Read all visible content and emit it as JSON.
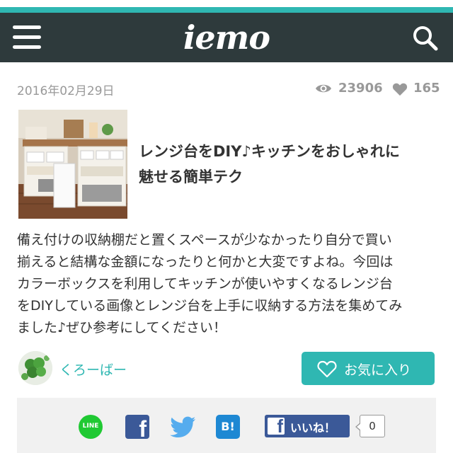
{
  "header": {
    "logo": "iemo",
    "menu_icon": "hamburger-menu-icon",
    "search_icon": "search-icon",
    "accent_color": "#2fb7b2",
    "bar_color": "#2e3a3c"
  },
  "article": {
    "date": "2016年02月29日",
    "views": "23906",
    "likes": "165",
    "title_line1": "レンジ台をDIY♪キッチンをおしゃれに",
    "title_line2": "魅せる簡単テク",
    "body_lines": [
      "備え付けの収納棚だと置くスペースが少なかったり自分で買い",
      "揃えると結構な金額になったりと何かと大変ですよね。今回は",
      "カラーボックスを利用してキッチンが使いやすくなるレンジ台",
      "をDIYしている画像とレンジ台を上手に収納する方法を集めてみ",
      "ました♪ぜひ参考にしてください！"
    ]
  },
  "author": {
    "name": "くろーばー"
  },
  "favorite_button": {
    "label": "お気に入り"
  },
  "share": {
    "line_label": "LINE",
    "facebook_glyph": "f",
    "hatena_label": "B!",
    "fb_like_label": "いいね！",
    "fb_like_count": "0"
  }
}
